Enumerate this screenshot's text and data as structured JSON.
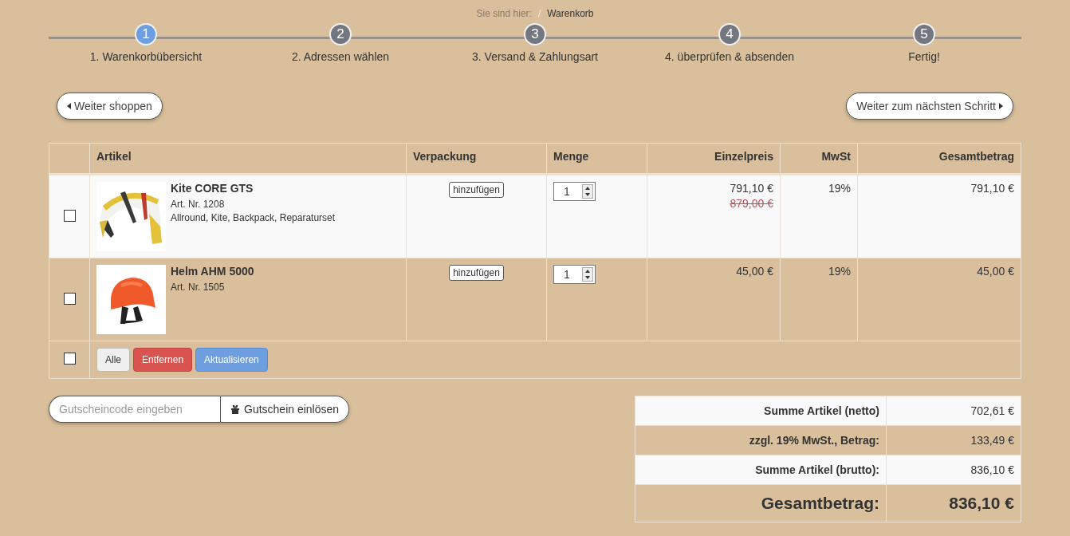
{
  "breadcrumb": {
    "label": "Sie sind hier:",
    "separator": "/",
    "current": "Warenkorb"
  },
  "steps": [
    {
      "number": "1",
      "label": "1. Warenkorbübersicht",
      "selected": true
    },
    {
      "number": "2",
      "label": "2. Adressen wählen",
      "selected": false
    },
    {
      "number": "3",
      "label": "3. Versand & Zahlungsart",
      "selected": false
    },
    {
      "number": "4",
      "label": "4. überprüfen & absenden",
      "selected": false
    },
    {
      "number": "5",
      "label": "Fertig!",
      "selected": false
    }
  ],
  "nav": {
    "back": "Weiter shoppen",
    "next": "Weiter zum nächsten Schritt"
  },
  "table": {
    "columns": [
      "Artikel",
      "Verpackung",
      "Menge",
      "Einzelpreis",
      "MwSt",
      "Gesamtbetrag"
    ],
    "rows": [
      {
        "checked": false,
        "name": "Kite CORE GTS",
        "article_no": "Art. Nr. 1208",
        "details": "Allround, Kite, Backpack, Reparaturset",
        "packaging_button": "hinzufügen",
        "quantity": "1",
        "price": "791,10 €",
        "old_price": "879,00 €",
        "vat": "19%",
        "total": "791,10 €"
      },
      {
        "checked": false,
        "name": "Helm AHM 5000",
        "article_no": "Art. Nr. 1505",
        "packaging_button": "hinzufügen",
        "quantity": "1",
        "price": "45,00 €",
        "vat": "19%",
        "total": "45,00 €"
      }
    ],
    "footer": {
      "checked": false,
      "buttons": [
        {
          "label": "Alle",
          "kind": "default"
        },
        {
          "label": "Entfernen",
          "kind": "danger"
        },
        {
          "label": "Aktualisieren",
          "kind": "primary"
        }
      ]
    }
  },
  "coupon": {
    "placeholder": "Gutscheincode eingeben",
    "button": "Gutschein einlösen"
  },
  "summary": [
    {
      "label": "Summe Artikel (netto)",
      "value": "702,61 €",
      "kind": "normal"
    },
    {
      "label": "zzgl. 19% MwSt., Betrag:",
      "value": "133,49 €",
      "kind": "normal"
    },
    {
      "label": "Summe Artikel (brutto):",
      "value": "836,10 €",
      "kind": "normal"
    },
    {
      "label": "Gesamtbetrag:",
      "value": "836,10 €",
      "kind": "grand"
    }
  ]
}
